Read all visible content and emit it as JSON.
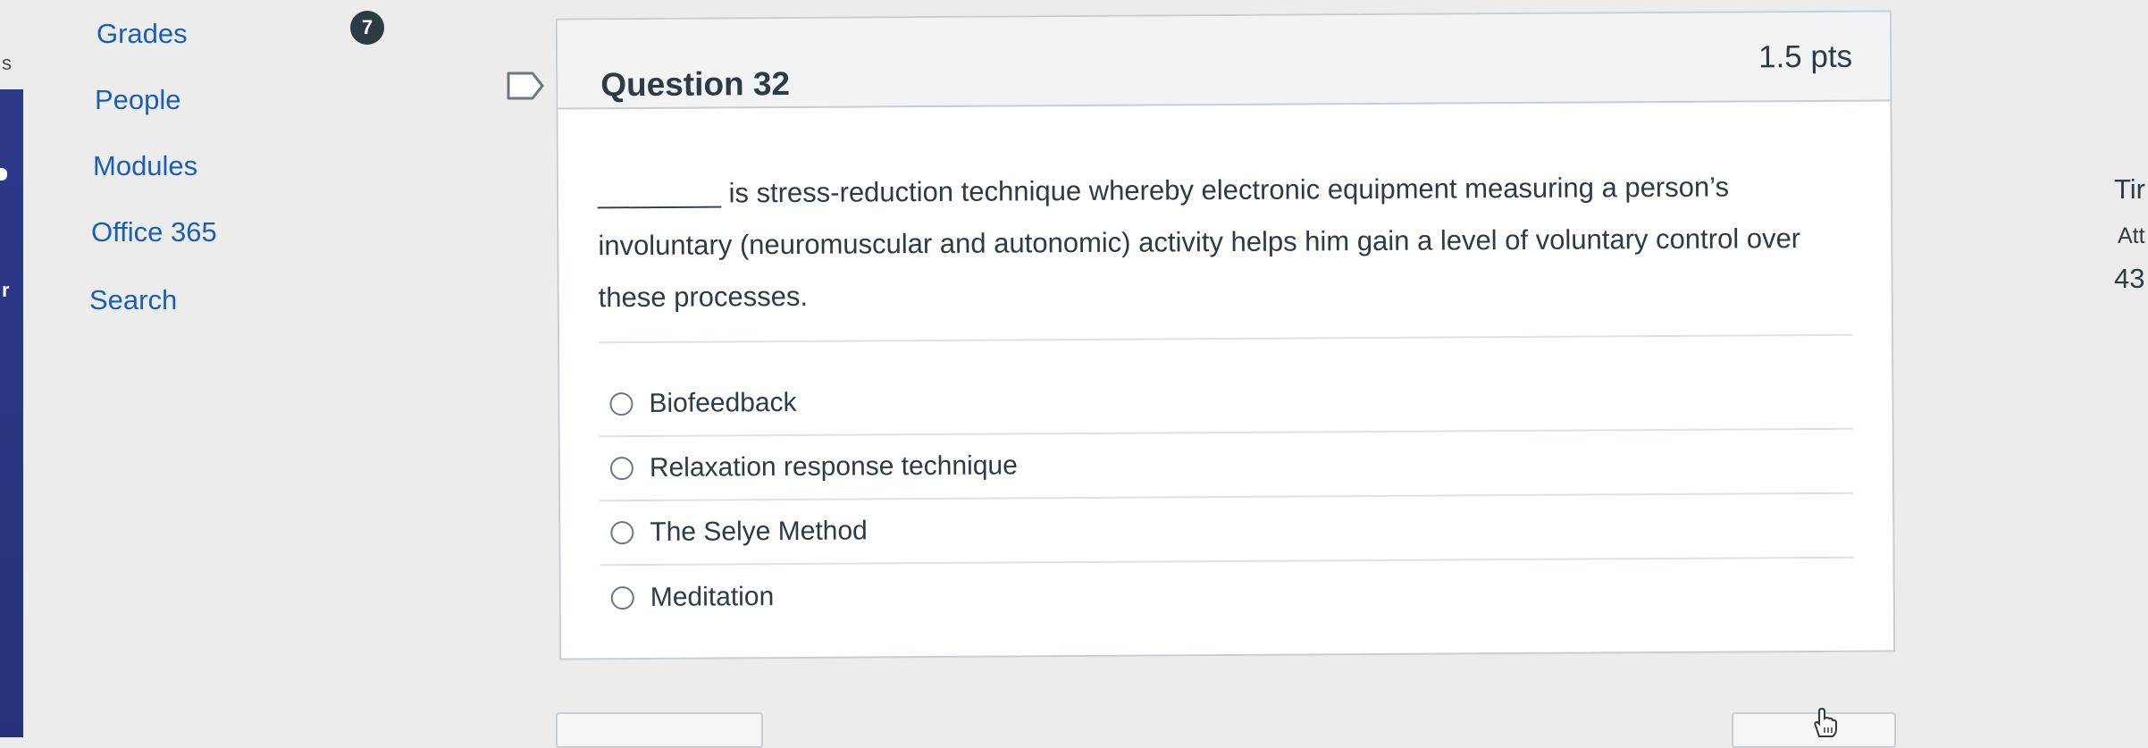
{
  "left_edge": {
    "top_letter": "s",
    "bottom_letter": "r"
  },
  "course_nav": {
    "items": [
      "Grades",
      "People",
      "Modules",
      "Office 365",
      "Search"
    ],
    "badge_count": "7"
  },
  "question": {
    "title": "Question 32",
    "points": "1.5 pts",
    "text": "________ is stress-reduction technique whereby electronic equipment measuring a person’s involuntary (neuromuscular and autonomic) activity helps him gain a level of voluntary control over these processes.",
    "answers": [
      "Biofeedback",
      "Relaxation response technique",
      "The Selye Method",
      "Meditation"
    ]
  },
  "right_panel": {
    "line1": "Tir",
    "line2": "Att",
    "line3": "43"
  },
  "icons": [
    "flag-icon",
    "radio-icon",
    "hand-cursor-icon"
  ],
  "colors": {
    "link": "#1a5fb4",
    "nav_bar": "#2d3b8a",
    "badge": "#2d3b45",
    "text": "#2d3b45"
  }
}
